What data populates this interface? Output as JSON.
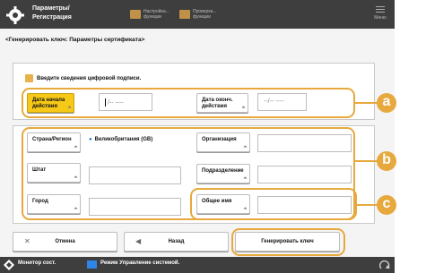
{
  "header": {
    "title": "Параметры/ Регистрация",
    "btn1": "Настройка... функции",
    "btn2": "Проверка... функции",
    "menu_label": "Меню"
  },
  "subtitle": "<Генерировать ключ: Параметры сертификата>",
  "info_label": "Введите сведения цифровой подписи.",
  "fields": {
    "valid_from_label": "Дата начала действия",
    "valid_from_value": "/-- ----",
    "valid_to_label": "Дата оконч. действия",
    "valid_to_value": "--/-- ----",
    "country_label": "Страна/Регион",
    "country_value": "Великобритания (GB)",
    "state_label": "Штат",
    "city_label": "Город",
    "org_label": "Организация",
    "unit_label": "Подразделение",
    "common_name_label": "Общее имя"
  },
  "callouts": {
    "a": "a",
    "b": "b",
    "c": "c"
  },
  "buttons": {
    "cancel": "Отмена",
    "back": "Назад",
    "generate": "Генерировать ключ"
  },
  "status": {
    "monitor": "Монитор сост.",
    "message": "Режим Управление системой."
  },
  "colors": {
    "accent": "#e7a93d",
    "active_label": "#f6c918",
    "header_bg": "#3e3e3e"
  }
}
